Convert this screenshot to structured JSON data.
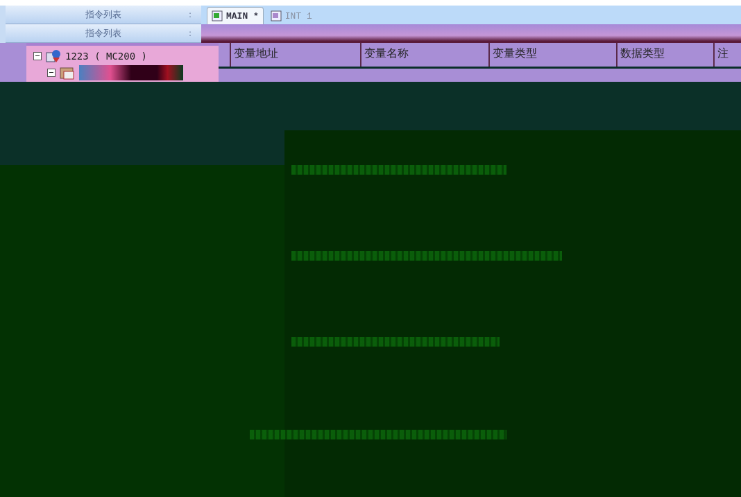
{
  "sidebar": {
    "panels": [
      {
        "title": "指令列表",
        "grip": ":"
      },
      {
        "title": "指令列表",
        "grip": ":"
      }
    ],
    "tree": {
      "label": "1223 ( MC200 )",
      "expanded": true,
      "children": [
        {
          "expanded": true
        }
      ]
    }
  },
  "tabs": [
    {
      "label": "MAIN *",
      "selected": true
    },
    {
      "label": "INT 1",
      "selected": false
    }
  ],
  "table": {
    "columns": [
      "变量地址",
      "变量名称",
      "变量类型",
      "数据类型",
      "注"
    ]
  }
}
